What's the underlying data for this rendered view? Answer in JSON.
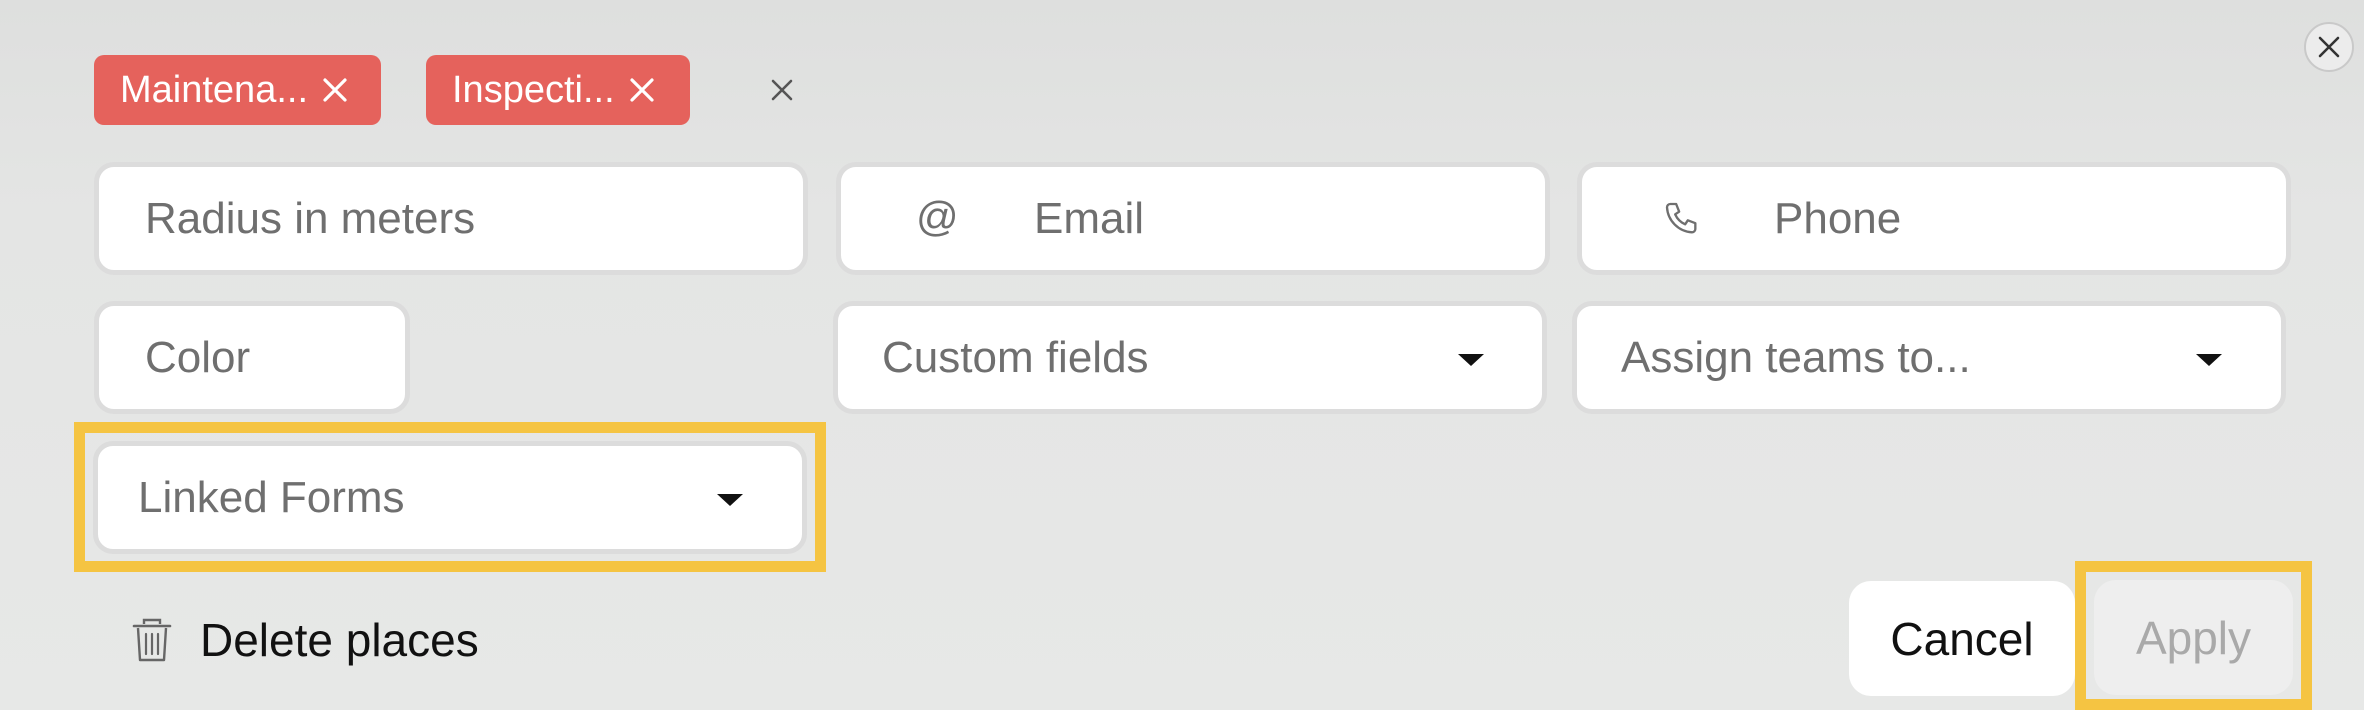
{
  "tags": [
    {
      "label": "Maintena..."
    },
    {
      "label": "Inspecti..."
    }
  ],
  "fields": {
    "radius_placeholder": "Radius in meters",
    "email_placeholder": "Email",
    "email_prefix": "@",
    "phone_placeholder": "Phone",
    "color_placeholder": "Color",
    "custom_fields_label": "Custom fields",
    "assign_teams_label": "Assign teams to...",
    "linked_forms_label": "Linked Forms"
  },
  "actions": {
    "delete_label": "Delete places",
    "cancel_label": "Cancel",
    "apply_label": "Apply"
  },
  "colors": {
    "tag": "#e5625c",
    "highlight": "#f5c442",
    "apply_disabled_text": "#a9a9a9"
  },
  "icons": {
    "close": "close-icon",
    "tag_remove": "x-icon",
    "clear_tags": "x-icon",
    "email": "at-icon",
    "phone": "phone-icon",
    "delete": "trash-icon",
    "dropdown": "caret-down-icon"
  }
}
